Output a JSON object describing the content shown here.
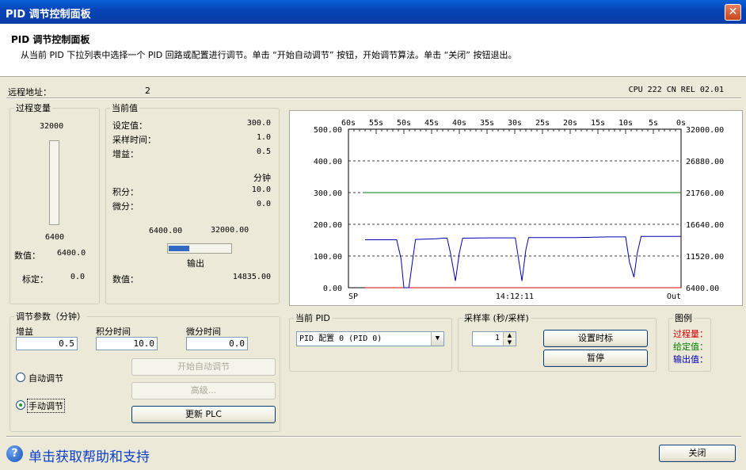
{
  "window": {
    "title": "PID 调节控制面板",
    "close_glyph": "✕"
  },
  "header": {
    "title": "PID 调节控制面板",
    "description": "从当前 PID 下拉列表中选择一个 PID 回路或配置进行调节。单击 “开始自动调节” 按钮，开始调节算法。单击 “关闭” 按钮退出。"
  },
  "remote": {
    "label": "远程地址：",
    "value": "2",
    "cpu": "CPU 222 CN REL 02.01"
  },
  "process_variable": {
    "legend": "过程变量",
    "max": "32000",
    "min": "6400",
    "value_label": "数值：",
    "value": "6400.0",
    "scale_label": "标定：",
    "scale": "0.0",
    "level_fraction": 0.0
  },
  "current_values": {
    "legend": "当前值",
    "setpoint_label": "设定值：",
    "setpoint": "300.0",
    "sample_label": "采样时间：",
    "sample": "1.0",
    "gain_label": "增益：",
    "gain": "0.5",
    "minute_label": "分钟",
    "integral_label": "积分：",
    "integral": "10.0",
    "derivative_label": "微分：",
    "derivative": "0.0",
    "out_min": "6400.00",
    "out_max": "32000.00",
    "output_label": "输出",
    "output_fraction": 0.33,
    "value_label": "数值：",
    "value": "14835.00"
  },
  "tuning": {
    "legend": "调节参数（分钟）",
    "gain_label": "增益",
    "gain": "0.5",
    "integral_label": "积分时间",
    "integral": "10.0",
    "derivative_label": "微分时间",
    "derivative": "0.0",
    "auto_label": "自动调节",
    "manual_label": "手动调节",
    "selected_mode": "manual",
    "start_auto_button": "开始自动调节",
    "advanced_button": "高级...",
    "update_plc_button": "更新 PLC"
  },
  "current_pid": {
    "legend": "当前 PID",
    "selected": "PID 配置 0 (PID 0)"
  },
  "sample_rate": {
    "legend": "采样率 (秒/采样)",
    "value": "1",
    "set_marker_button": "设置时标",
    "pause_button": "暂停"
  },
  "legend_box": {
    "legend": "图例",
    "items": [
      {
        "label": "过程量：",
        "color": "#d40000"
      },
      {
        "label": "给定值：",
        "color": "#008000"
      },
      {
        "label": "输出值：",
        "color": "#0000b0"
      }
    ]
  },
  "footer": {
    "help_text": "单击获取帮助和支持",
    "help_icon": "question-icon",
    "close_button": "关闭"
  },
  "chart_data": {
    "type": "line",
    "x_tick_labels": [
      "60s",
      "55s",
      "50s",
      "45s",
      "40s",
      "35s",
      "30s",
      "25s",
      "20s",
      "15s",
      "10s",
      "5s",
      "0s"
    ],
    "x_bottom_labels": {
      "left": "SP",
      "center": "14:12:11",
      "right": "Out"
    },
    "y_left_ticks": [
      "0.00",
      "100.00",
      "200.00",
      "300.00",
      "400.00",
      "500.00"
    ],
    "y_right_ticks": [
      "6400.00",
      "11520.00",
      "16640.00",
      "21760.00",
      "26880.00",
      "32000.00"
    ],
    "ylim_left": [
      0,
      500
    ],
    "ylim_right": [
      6400,
      32000
    ],
    "xlim_seconds_ago": [
      60,
      0
    ],
    "grid": "horizontal-dashed",
    "series": [
      {
        "color": "#d40000",
        "axis": "left",
        "points": [
          [
            57,
            0
          ],
          [
            0,
            0
          ]
        ]
      },
      {
        "color": "#008000",
        "axis": "left",
        "points": [
          [
            57,
            300
          ],
          [
            0,
            300
          ]
        ]
      },
      {
        "color": "#0000b0",
        "axis": "right",
        "points": [
          [
            57,
            14150
          ],
          [
            51.3,
            14150
          ],
          [
            50.5,
            11000
          ],
          [
            50.0,
            6400
          ],
          [
            49.1,
            6400
          ],
          [
            48.4,
            11000
          ],
          [
            47.9,
            14200
          ],
          [
            44.2,
            14300
          ],
          [
            43.0,
            14400
          ],
          [
            42.2,
            14400
          ],
          [
            41.6,
            12000
          ],
          [
            40.7,
            7500
          ],
          [
            40.0,
            12000
          ],
          [
            39.4,
            14400
          ],
          [
            34.6,
            14450
          ],
          [
            31.8,
            14450
          ],
          [
            29.9,
            14450
          ],
          [
            28.7,
            7500
          ],
          [
            28.0,
            12500
          ],
          [
            27.5,
            14500
          ],
          [
            19.0,
            14500
          ],
          [
            13.0,
            14600
          ],
          [
            10.8,
            14600
          ],
          [
            10.0,
            14600
          ],
          [
            9.3,
            10500
          ],
          [
            8.5,
            8100
          ],
          [
            7.9,
            12000
          ],
          [
            7.2,
            14700
          ],
          [
            4.5,
            14700
          ],
          [
            3.8,
            14700
          ],
          [
            3.2,
            14700
          ],
          [
            3.0,
            14700
          ],
          [
            0.5,
            14700
          ],
          [
            0,
            14700
          ]
        ]
      }
    ]
  }
}
